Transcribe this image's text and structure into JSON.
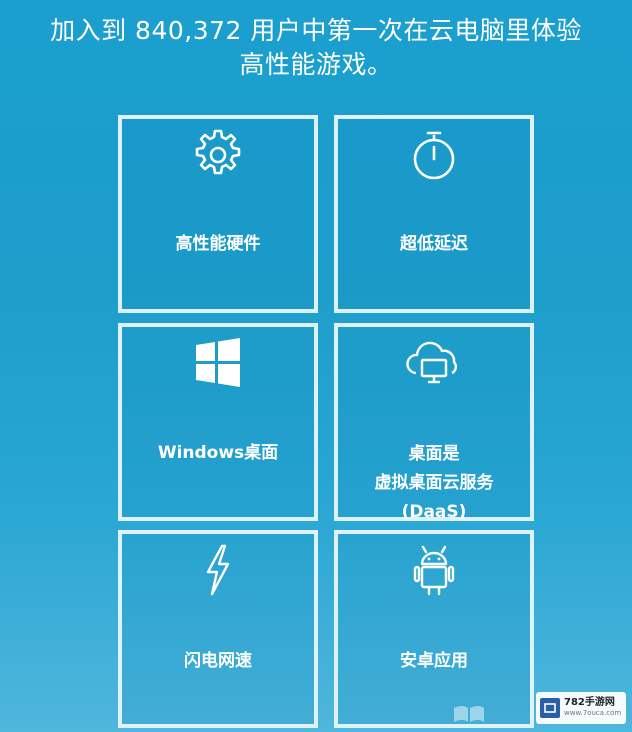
{
  "headline": {
    "line1": "加入到 840,372 用户中第一次在云电脑里体验",
    "line2": "高性能游戏。"
  },
  "features": [
    {
      "icon": "gear-icon",
      "lines": [
        "高性能硬件"
      ]
    },
    {
      "icon": "stopwatch-icon",
      "lines": [
        "超低延迟"
      ]
    },
    {
      "icon": "windows-logo-icon",
      "lines": [
        "Windows桌面"
      ]
    },
    {
      "icon": "cloud-monitor-icon",
      "lines": [
        "桌面是",
        "虚拟桌面云服务",
        "(DaaS)"
      ]
    },
    {
      "icon": "lightning-icon",
      "lines": [
        "闪电网速"
      ]
    },
    {
      "icon": "android-icon",
      "lines": [
        "安卓应用"
      ]
    }
  ],
  "watermark": {
    "title": "782手游网",
    "url": "www.7ouca.com"
  },
  "colors": {
    "background": "#1e9ecb",
    "tile_border": "#ecf8fc",
    "text": "#ffffff"
  }
}
